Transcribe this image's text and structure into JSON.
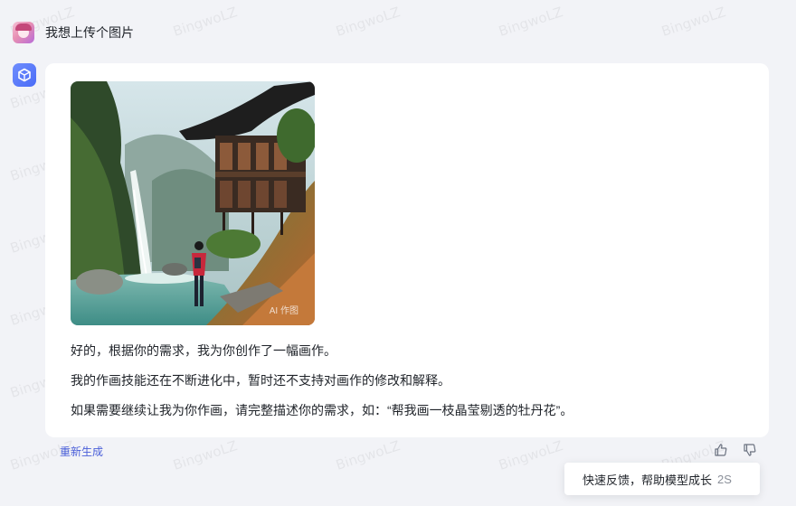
{
  "watermark": "BingwoLZ",
  "user": {
    "message": "我想上传个图片",
    "avatar_icon": "user-avatar-icon"
  },
  "bot": {
    "avatar_icon": "cube-bot-icon",
    "image_tag": "AI 作图",
    "paragraphs": [
      "好的，根据你的需求，我为你创作了一幅画作。",
      "我的作画技能还在不断进化中，暂时还不支持对画作的修改和解释。",
      "如果需要继续让我为你作画，请完整描述你的需求，如：“帮我画一枝晶莹剔透的牡丹花”。"
    ]
  },
  "actions": {
    "regenerate_label": "重新生成",
    "thumb_up_icon": "thumb-up-icon",
    "thumb_down_icon": "thumb-down-icon"
  },
  "toast": {
    "text": "快速反馈，帮助模型成长",
    "countdown": "2S"
  },
  "colors": {
    "page_bg": "#f2f3f7",
    "card_bg": "#ffffff",
    "link": "#4a5fd9",
    "bot_avatar": "#4a6cf7"
  }
}
